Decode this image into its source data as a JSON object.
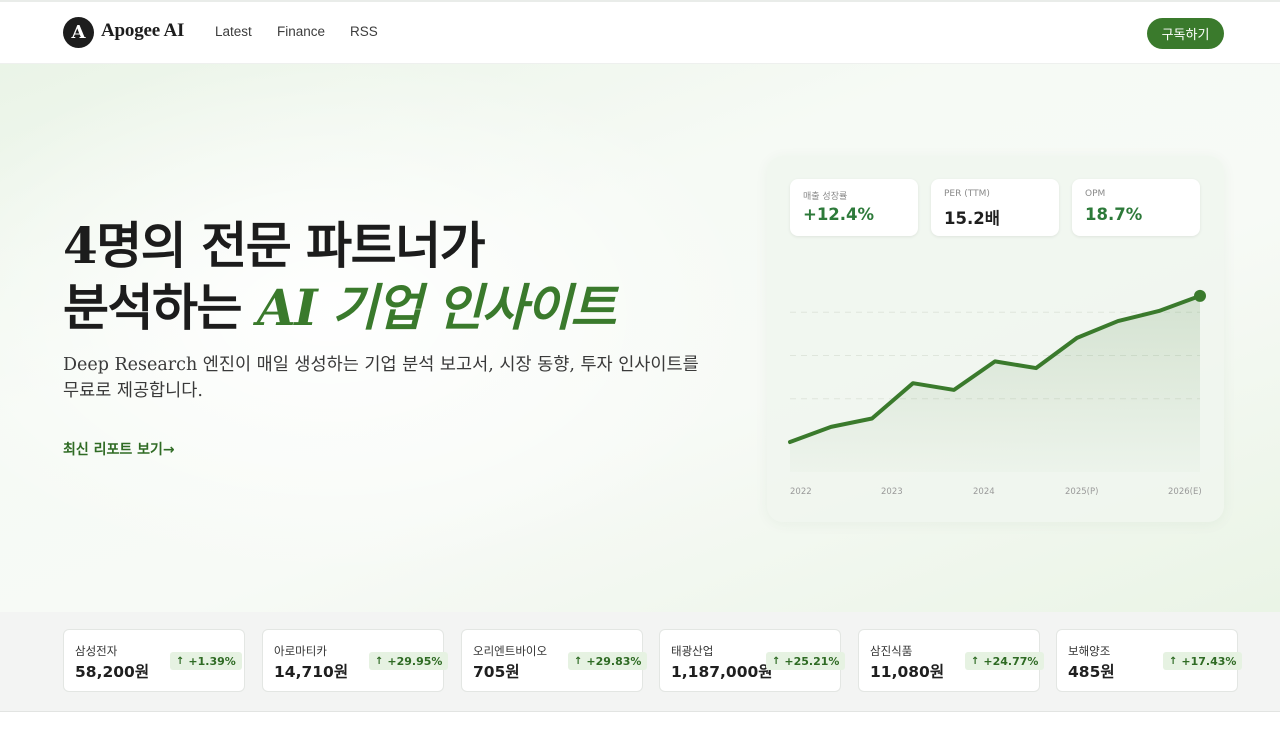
{
  "brand": {
    "logo_letter": "A",
    "name": "Apogee AI"
  },
  "nav": {
    "items": [
      "Latest",
      "Finance",
      "RSS"
    ]
  },
  "header": {
    "subscribe_label": "구독하기"
  },
  "hero": {
    "title_line1": "4명의 전문 파트너가",
    "title_line2_plain": "분석하는 ",
    "title_line2_accent": "AI 기업 인사이트",
    "description": "Deep Research 엔진이 매일 생성하는 기업 분석 보고서, 시장 동향, 투자 인사이트를 무료로 제공합니다.",
    "cta_label": "최신 리포트 보기→"
  },
  "metrics": [
    {
      "label": "매출 성장률",
      "value": "+12.4%",
      "positive": true
    },
    {
      "label": "PER (TTM)",
      "value": "15.2배",
      "positive": false
    },
    {
      "label": "OPM",
      "value": "18.7%",
      "positive": true
    }
  ],
  "chart_data": {
    "type": "area",
    "x_tick_labels": [
      "2022",
      "2023",
      "2024",
      "2025(P)",
      "2026(E)"
    ],
    "values": [
      0.0,
      0.09,
      0.14,
      0.35,
      0.31,
      0.48,
      0.44,
      0.62,
      0.72,
      0.78,
      0.87
    ],
    "ylim": [
      0,
      1
    ],
    "grid": "dashed horizontal",
    "accent_color": "#3a7a2c"
  },
  "tickers": [
    {
      "name": "삼성전자",
      "price": "58,200원",
      "change": "+1.39%"
    },
    {
      "name": "아로마티카",
      "price": "14,710원",
      "change": "+29.95%"
    },
    {
      "name": "오리엔트바이오",
      "price": "705원",
      "change": "+29.83%"
    },
    {
      "name": "태광산업",
      "price": "1,187,000원",
      "change": "+25.21%"
    },
    {
      "name": "삼진식품",
      "price": "11,080원",
      "change": "+24.77%"
    },
    {
      "name": "보해양조",
      "price": "485원",
      "change": "+17.43%"
    }
  ],
  "icons": {
    "up_arrow": "↑"
  }
}
